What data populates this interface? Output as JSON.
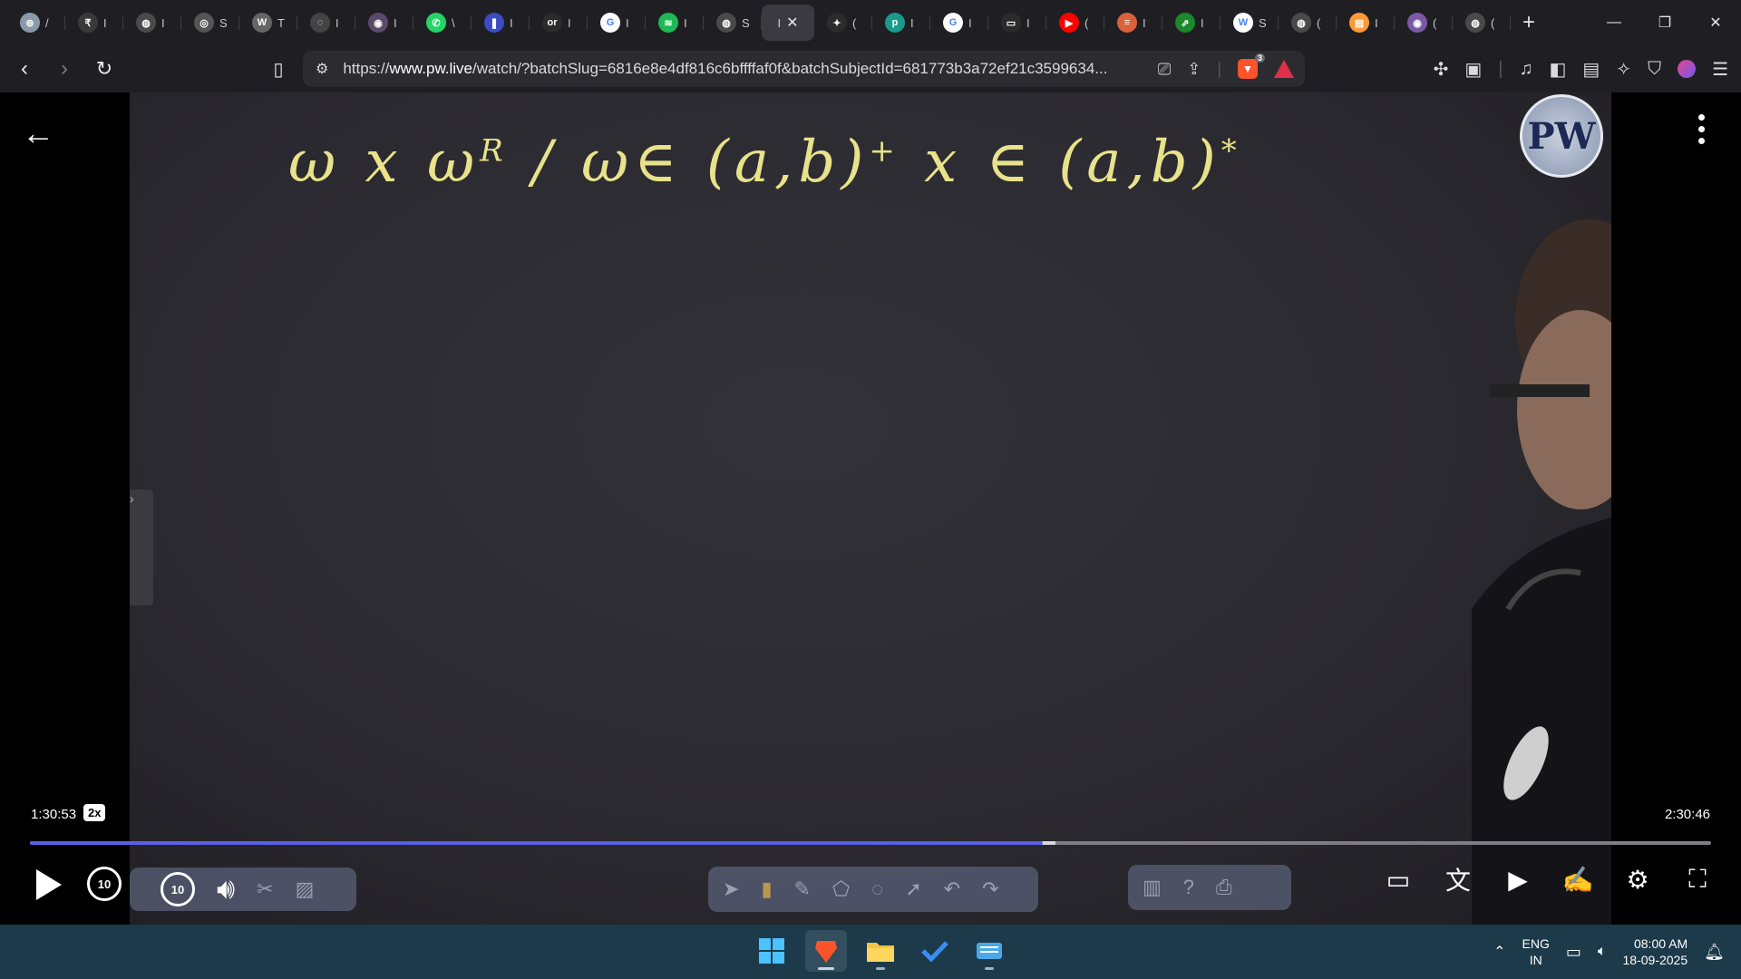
{
  "browser": {
    "tabs": [
      {
        "icon": "gpt-icon",
        "color": "#8a9aa8",
        "glyph": "⊚",
        "title": "/"
      },
      {
        "icon": "coin-icon",
        "color": "#3a3a3a",
        "glyph": "₹",
        "title": "I"
      },
      {
        "icon": "globe-icon",
        "color": "#4a4a4a",
        "glyph": "◍",
        "title": "I"
      },
      {
        "icon": "gradient-icon",
        "color": "#555",
        "glyph": "◎",
        "title": "S"
      },
      {
        "icon": "w3-icon",
        "color": "#666",
        "glyph": "W",
        "title": "T"
      },
      {
        "icon": "site-icon",
        "color": "#444",
        "glyph": "◌",
        "title": "I"
      },
      {
        "icon": "grammar-icon",
        "color": "#5a4a6a",
        "glyph": "◉",
        "title": "I"
      },
      {
        "icon": "whatsapp-icon",
        "color": "#25d366",
        "glyph": "✆",
        "title": "\\"
      },
      {
        "icon": "bookmark-ribbon-icon",
        "color": "#3b4cc0",
        "glyph": "❚",
        "title": "I"
      },
      {
        "icon": "oriip-icon",
        "color": "#2b2b2b",
        "glyph": "or",
        "title": "I"
      },
      {
        "icon": "google-icon",
        "color": "#ffffff",
        "glyph": "G",
        "title": "I"
      },
      {
        "icon": "spotify-icon",
        "color": "#1db954",
        "glyph": "≋",
        "title": "I"
      },
      {
        "icon": "globe-icon",
        "color": "#4a4a4a",
        "glyph": "◍",
        "title": "S"
      },
      {
        "icon": "active-tab",
        "active": true,
        "glyph": "I",
        "title": ""
      },
      {
        "icon": "gemini-icon",
        "color": "#2b2b2b",
        "glyph": "✦",
        "title": "("
      },
      {
        "icon": "pw-tab-icon",
        "color": "#1a9a8a",
        "glyph": "p",
        "title": "I"
      },
      {
        "icon": "google-icon",
        "color": "#ffffff",
        "glyph": "G",
        "title": "I"
      },
      {
        "icon": "screen-icon",
        "color": "#2b2b2b",
        "glyph": "▭",
        "title": "I"
      },
      {
        "icon": "youtube-icon",
        "color": "#ff0000",
        "glyph": "▶",
        "title": "("
      },
      {
        "icon": "burger-icon",
        "color": "#d9623a",
        "glyph": "≡",
        "title": "I"
      },
      {
        "icon": "chart-tab-icon",
        "color": "#1a8a2a",
        "glyph": "⇗",
        "title": "I"
      },
      {
        "icon": "wikipedia-icon",
        "color": "#ffffff",
        "glyph": "W",
        "title": "S"
      },
      {
        "icon": "globe-icon",
        "color": "#4a4a4a",
        "glyph": "◍",
        "title": "("
      },
      {
        "icon": "india-flag-icon",
        "color": "#ff9933",
        "glyph": "▤",
        "title": "I"
      },
      {
        "icon": "camera-icon",
        "color": "#7a5aa8",
        "glyph": "◉",
        "title": "("
      },
      {
        "icon": "globe-icon",
        "color": "#4a4a4a",
        "glyph": "◍",
        "title": "("
      }
    ],
    "url_prefix": "https://",
    "url_host": "www.pw.live",
    "url_path": "/watch/?batchSlug=6816e8e4df816c6bffffaf0f&batchSubjectId=681773b3a72ef21c3599634...",
    "brave_badge_count": "3"
  },
  "video": {
    "chalk_left": "ω x ω",
    "chalk_sup1": "R",
    "chalk_mid": " / ω∈ (a,b)",
    "chalk_sup2": "+",
    "chalk_right": "  x ∈ (a,b)",
    "chalk_sup3": "*",
    "logo": "PW",
    "current_time": "1:30:53",
    "speed": "2x",
    "total_time": "2:30:46",
    "progress_fraction": 0.6027,
    "buffered_fraction": 0.61,
    "skip_back": "10",
    "skip_forward": "10"
  },
  "taskbar": {
    "lang_top": "ENG",
    "lang_bottom": "IN",
    "time": "08:00 AM",
    "date": "18-09-2025"
  }
}
